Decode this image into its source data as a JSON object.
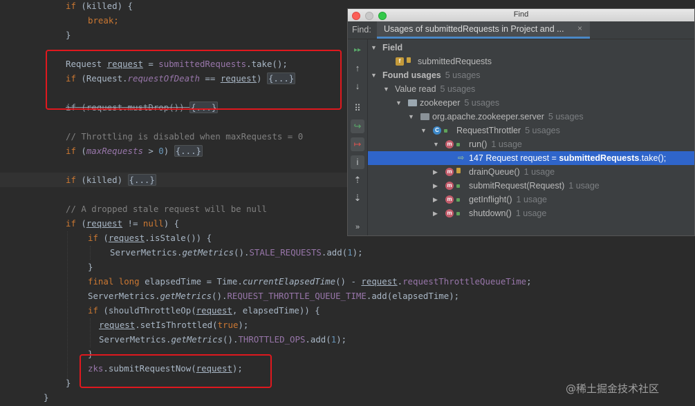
{
  "editor": {
    "lines": {
      "l1_if": "if",
      "l1_rest": " (killed) {",
      "l2_break": "break;",
      "l3": "}",
      "l4_type": "Request ",
      "l4_var": "request",
      "l4_mid": " = ",
      "l4_field": "submittedRequests",
      "l4_end": ".take();",
      "l5_if": "if",
      "l5_a": " (Request.",
      "l5_field": "requestOfDeath",
      "l5_b": " == ",
      "l5_var": "request",
      "l5_c": ") ",
      "l5_fold": "{...}",
      "l6_text": "if (request.mustDrop()) ",
      "l6_fold": "{...}",
      "l7_comment": "// Throttling is disabled when maxRequests = 0",
      "l8_if": "if",
      "l8_a": " (",
      "l8_field": "maxRequests",
      "l8_b": " > ",
      "l8_num": "0",
      "l8_c": ") ",
      "l8_fold": "{...}",
      "l9_if": "if",
      "l9_a": " (killed) ",
      "l9_fold": "{...}",
      "l10_comment": "// A dropped stale request will be null",
      "l11_if": "if",
      "l11_a": " (",
      "l11_var": "request",
      "l11_b": " != ",
      "l11_null": "null",
      "l11_c": ") {",
      "l12_if": "if",
      "l12_a": " (",
      "l12_var": "request",
      "l12_b": ".isStale()) {",
      "l13_a": "ServerMetrics.",
      "l13_m": "getMetrics",
      "l13_b": "().",
      "l13_field": "STALE_REQUESTS",
      "l13_c": ".add(",
      "l13_num": "1",
      "l13_d": ");",
      "l14": "}",
      "l15_kw": "final long",
      "l15_a": " elapsedTime = Time.",
      "l15_m": "currentElapsedTime",
      "l15_b": "() - ",
      "l15_var": "request",
      "l15_c": ".",
      "l15_field": "requestThrottleQueueTime",
      "l15_d": ";",
      "l16_a": "ServerMetrics.",
      "l16_m": "getMetrics",
      "l16_b": "().",
      "l16_field": "REQUEST_THROTTLE_QUEUE_TIME",
      "l16_c": ".add(elapsedTime);",
      "l17_if": "if",
      "l17_a": " (shouldThrottleOp(",
      "l17_var": "request",
      "l17_b": ", elapsedTime)) {",
      "l18_var": "request",
      "l18_a": ".setIsThrottled(",
      "l18_true": "true",
      "l18_b": ");",
      "l19_a": "ServerMetrics.",
      "l19_m": "getMetrics",
      "l19_b": "().",
      "l19_field": "THROTTLED_OPS",
      "l19_c": ".add(",
      "l19_num": "1",
      "l19_d": ");",
      "l20": "}",
      "l21_field": "zks",
      "l21_a": ".submitRequestNow(",
      "l21_var": "request",
      "l21_b": ");",
      "l22": "}",
      "l23": "}"
    }
  },
  "find": {
    "window_title": "Find",
    "label": "Find:",
    "tab_title": "Usages of submittedRequests in Project and ...",
    "tab_close": "×",
    "toolbar": {
      "rerun": "▸▸",
      "up": "↑",
      "down": "↓",
      "group": "⠿",
      "read": "↪",
      "write": "↦",
      "info": "i",
      "expand": "⇡",
      "collapse": "⇣",
      "more": "»"
    },
    "tree": {
      "field_header": "Field",
      "field_name": "submittedRequests",
      "found_usages": "Found usages",
      "found_usages_count": "5 usages",
      "value_read": "Value read",
      "value_read_count": "5 usages",
      "module": "zookeeper",
      "module_count": "5 usages",
      "package": "org.apache.zookeeper.server",
      "package_count": "5 usages",
      "class_name": "RequestThrottler",
      "class_count": "5 usages",
      "method_run": "run()",
      "method_run_count": "1 usage",
      "usage_line_num": "147",
      "usage_pre": "Request request = ",
      "usage_match": "submittedRequests",
      "usage_post": ".take();",
      "methods": [
        {
          "name": "drainQueue()",
          "count": "1 usage"
        },
        {
          "name": "submitRequest(Request)",
          "count": "1 usage"
        },
        {
          "name": "getInflight()",
          "count": "1 usage"
        },
        {
          "name": "shutdown()",
          "count": "1 usage"
        }
      ]
    }
  },
  "watermark": "@稀土掘金技术社区",
  "colors": {
    "editor_bg": "#2b2b2b",
    "keyword": "#cc7832",
    "field": "#9876aa",
    "number": "#6897bb",
    "comment": "#808080",
    "selection": "#2f65ca",
    "red_box": "#e0181e"
  }
}
